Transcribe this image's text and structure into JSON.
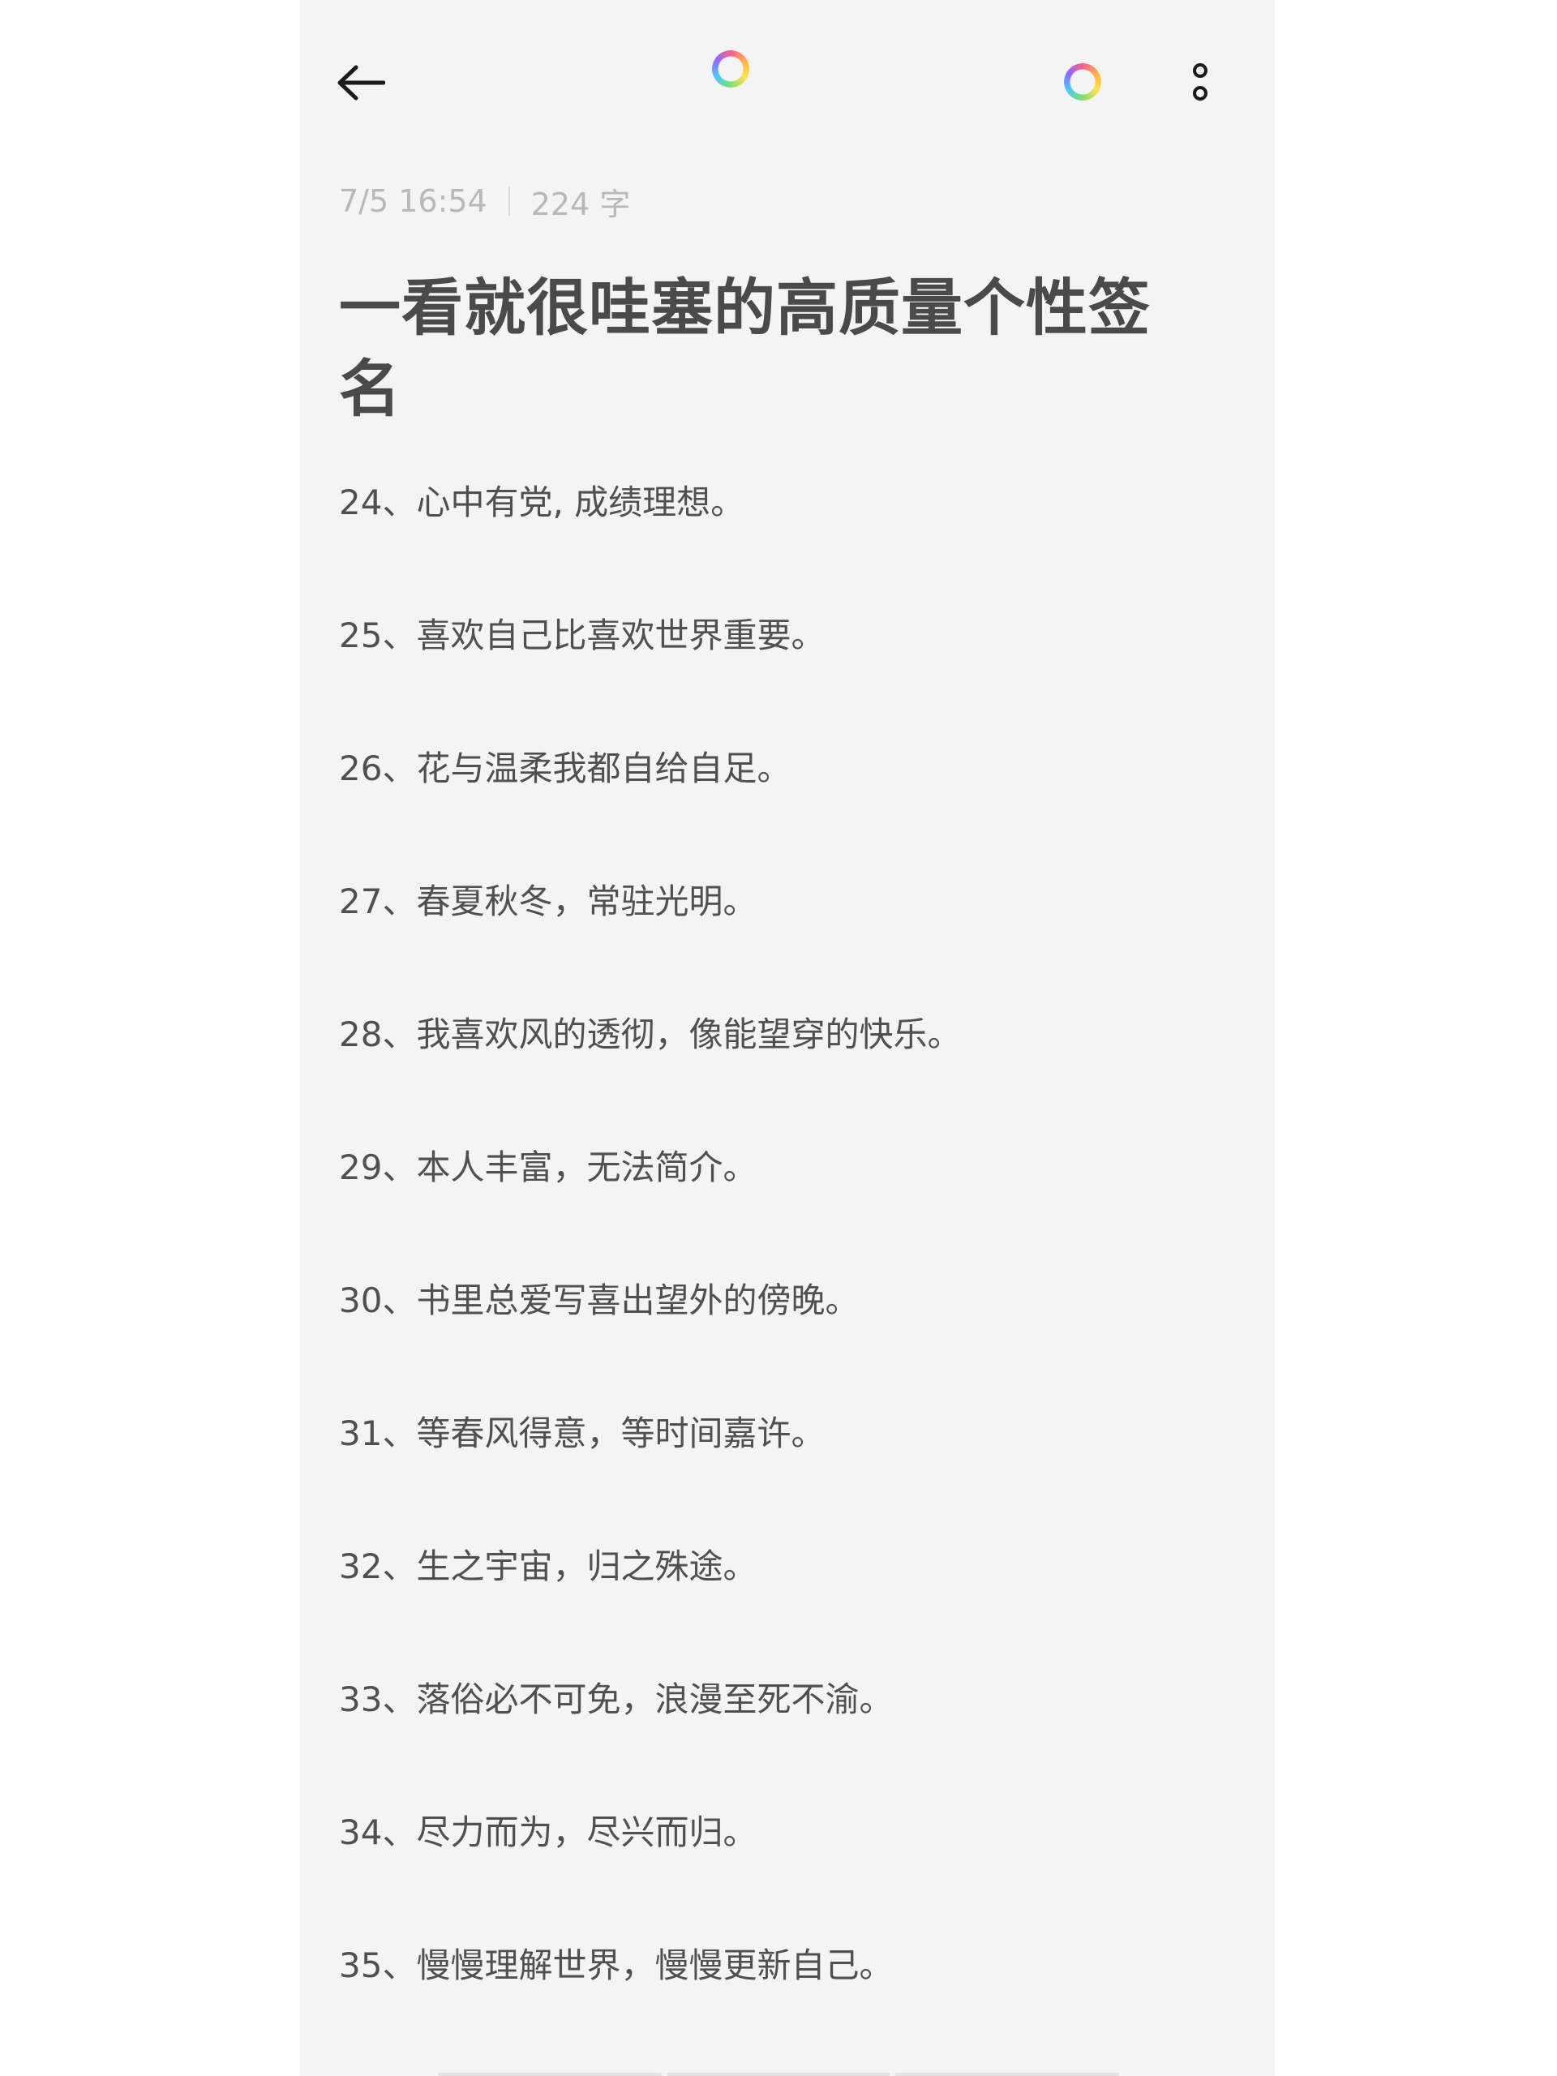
{
  "header": {
    "back_icon": "arrow-left-icon",
    "center_icon": "rainbow-ring-icon",
    "right_icon": "rainbow-ring-icon",
    "more_icon": "more-vertical-icon"
  },
  "meta": {
    "datetime": "7/5 16:54",
    "word_count": "224 字"
  },
  "note": {
    "title": "一看就很哇塞的高质量个性签名",
    "items": [
      "24、心中有党, 成绩理想。",
      "25、喜欢自己比喜欢世界重要。",
      "26、花与温柔我都自给自足。",
      "27、春夏秋冬，常驻光明。",
      "28、我喜欢风的透彻，像能望穿的快乐。",
      "29、本人丰富，无法简介。",
      "30、书里总爱写喜出望外的傍晚。",
      "31、等春风得意，等时间嘉许。",
      "32、生之宇宙，归之殊途。",
      "33、落俗必不可免，浪漫至死不渝。",
      "34、尽力而为，尽兴而归。",
      "35、慢慢理解世界，慢慢更新自己。"
    ]
  },
  "colors": {
    "background": "#f4f4f4",
    "title": "#4a4a4a",
    "text": "#505050",
    "meta": "#b8b8b8"
  }
}
